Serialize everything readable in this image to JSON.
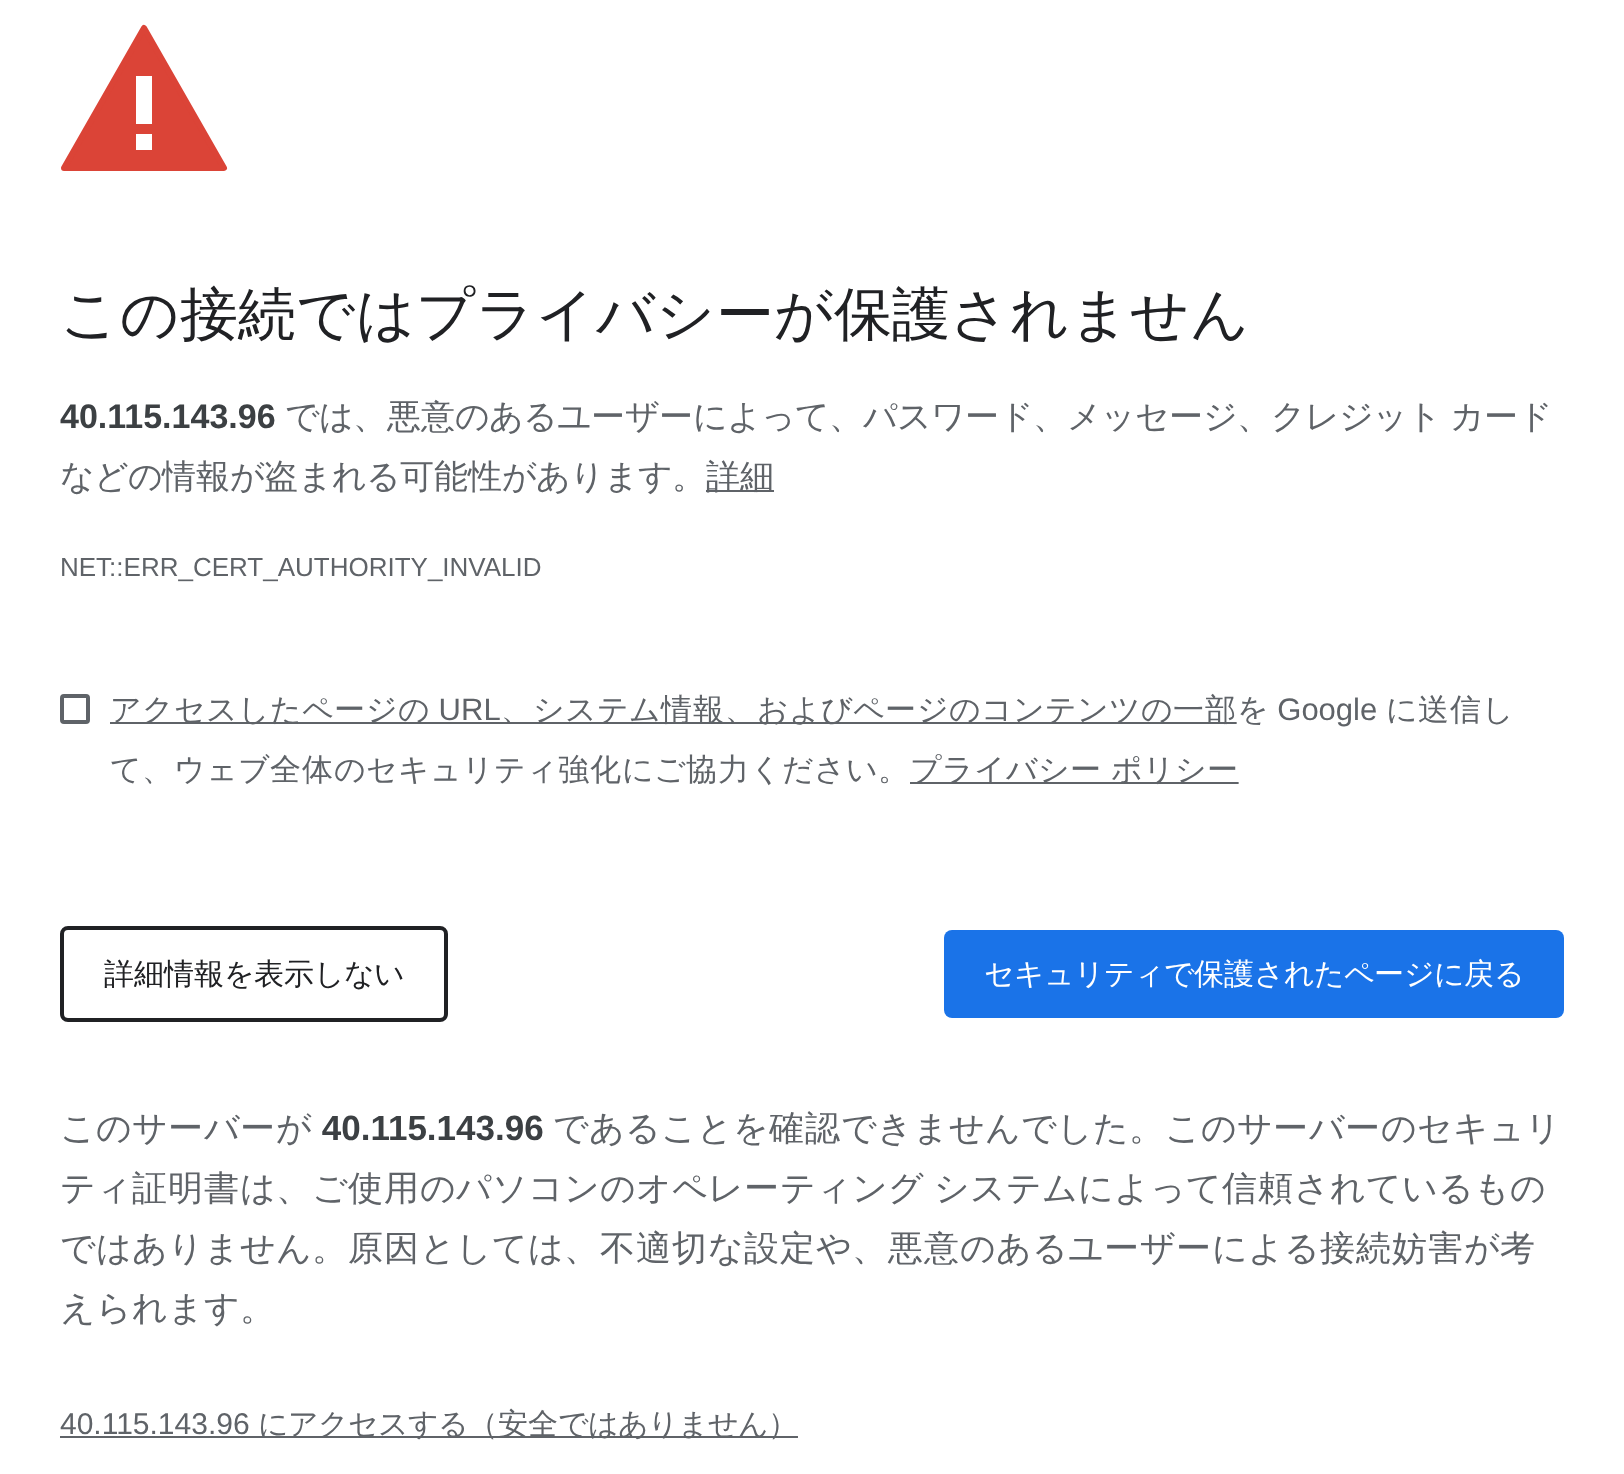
{
  "title": "この接続ではプライバシーが保護されません",
  "description": {
    "text": "**40.115.143.96** では、悪意のあるユーザーによって、パスワード、メッセージ、クレジット カードなどの情報が盗まれる可能性があります。",
    "link": "詳細"
  },
  "error_code": "NET::ERR_CERT_AUTHORITY_INVALID",
  "report": {
    "checked": false,
    "link": "アクセスしたページの URL、システム情報、およびページのコンテンツの一部",
    "text": "を Google に送信して、ウェブ全体のセキュリティ強化にご協力ください。",
    "policy_link": "プライバシー ポリシー"
  },
  "buttons": [
    {
      "kind": "secondary",
      "label": "詳細情報を表示しない"
    },
    {
      "kind": "primary",
      "label": "セキュリティで保護されたページに戻る"
    }
  ],
  "explanation": "このサーバーが **40.115.143.96** であることを確認できませんでした。このサーバーのセキュリティ証明書は、ご使用のパソコンのオペレーティング システムによって信頼されているものではありません。原因としては、不適切な設定や、悪意のあるユーザーによる接続妨害が考えられます。",
  "proceed_link": "40.115.143.96 にアクセスする（安全ではありません）"
}
